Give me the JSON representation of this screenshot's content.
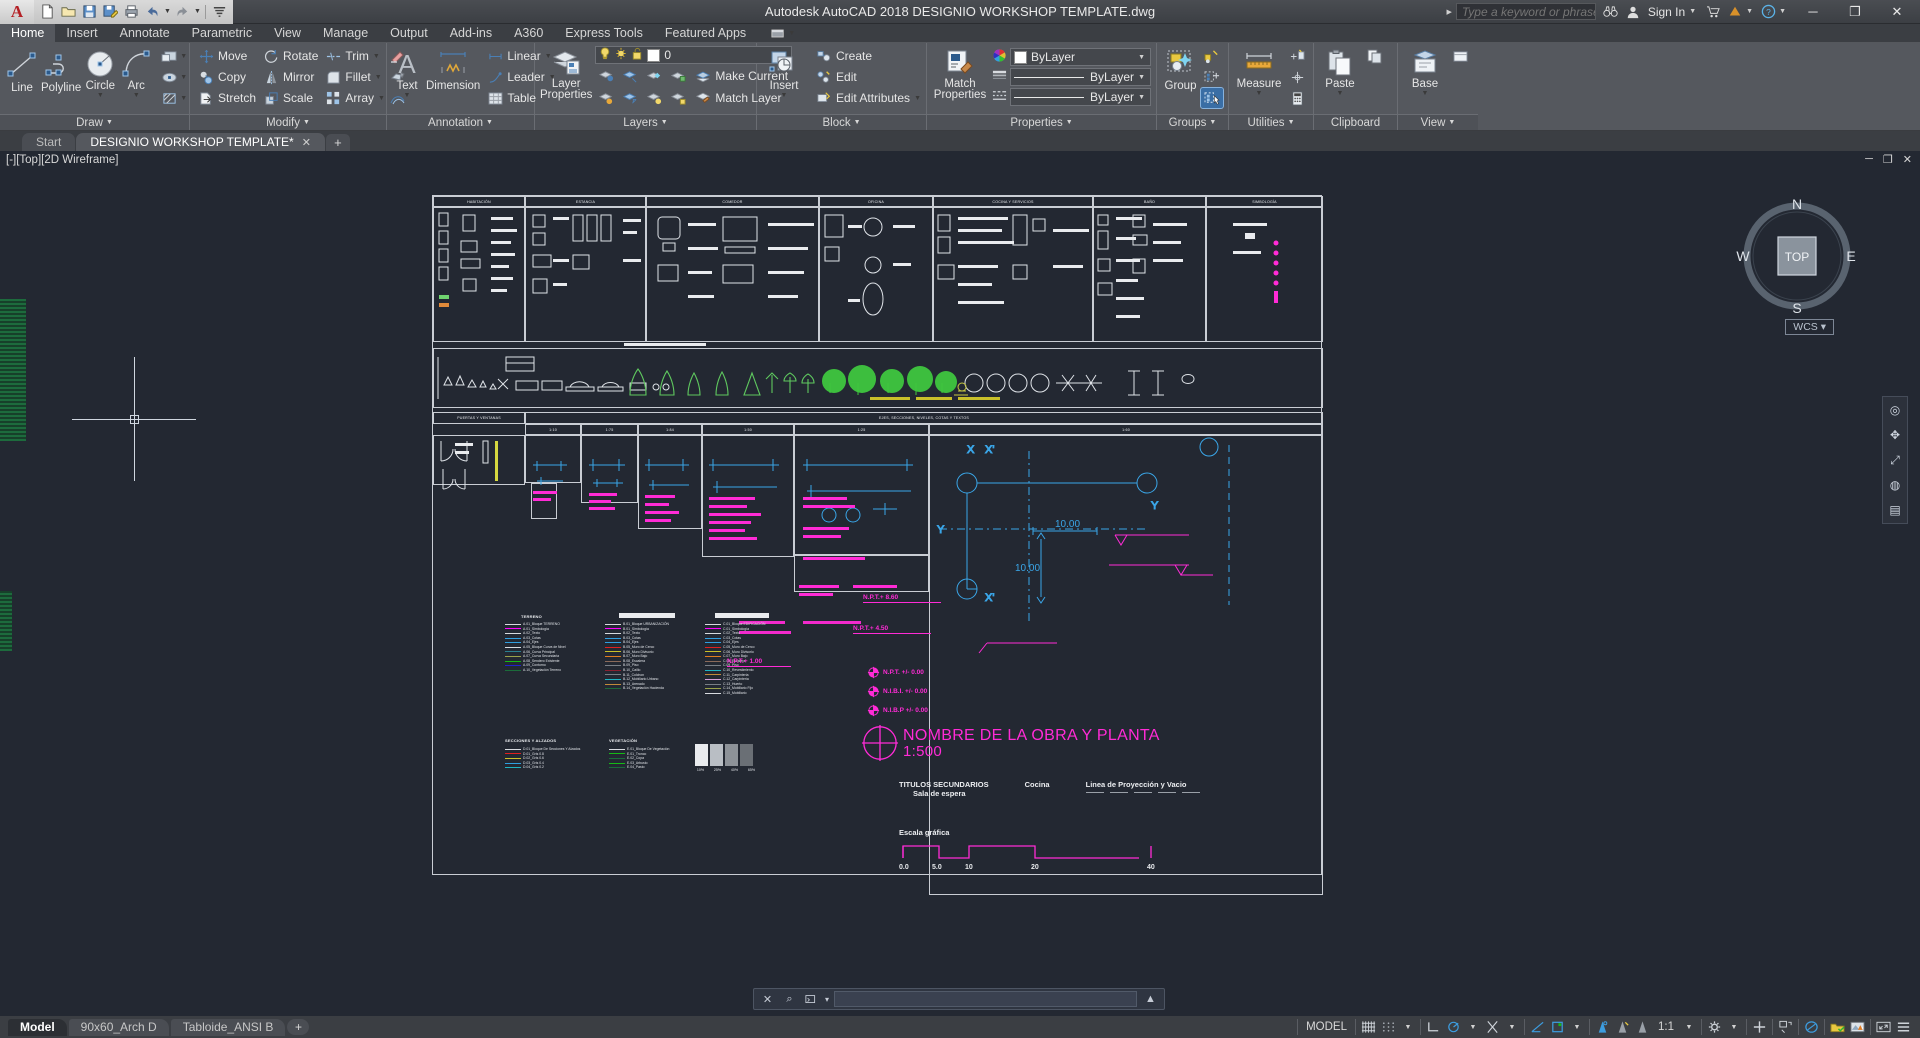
{
  "titlebar": {
    "app_name": "A",
    "title": "Autodesk AutoCAD 2018    DESIGNIO WORKSHOP TEMPLATE.dwg",
    "search_placeholder": "Type a keyword or phrase",
    "signin_label": "Sign In",
    "quick_access": [
      {
        "name": "new-icon",
        "glyph": "▢"
      },
      {
        "name": "open-icon",
        "glyph": "▱"
      },
      {
        "name": "save-icon",
        "glyph": "▣"
      },
      {
        "name": "saveas-icon",
        "glyph": "▤"
      },
      {
        "name": "plot-icon",
        "glyph": "⎙"
      },
      {
        "name": "undo-icon",
        "glyph": "↩"
      },
      {
        "name": "redo-icon",
        "glyph": "↪"
      },
      {
        "name": "customize-icon",
        "glyph": "≡"
      }
    ],
    "window_buttons": {
      "minimize": "─",
      "restore": "❐",
      "close": "✕"
    }
  },
  "ribbon_tabs": {
    "items": [
      "Home",
      "Insert",
      "Annotate",
      "Parametric",
      "View",
      "Manage",
      "Output",
      "Add-ins",
      "A360",
      "Express Tools",
      "Featured Apps"
    ],
    "active": "Home"
  },
  "ribbon": {
    "draw": {
      "title": "Draw",
      "big": [
        {
          "label": "Line",
          "icon": "line-icon"
        },
        {
          "label": "Polyline",
          "icon": "polyline-icon"
        },
        {
          "label": "Circle",
          "icon": "circle-icon",
          "has_menu": true
        },
        {
          "label": "Arc",
          "icon": "arc-icon",
          "has_menu": true
        }
      ],
      "small_icons": [
        {
          "name": "rectangle-icon"
        },
        {
          "name": "ellipse-icon"
        },
        {
          "name": "hatch-icon"
        }
      ]
    },
    "modify": {
      "title": "Modify",
      "col1": [
        "Move",
        "Copy",
        "Stretch"
      ],
      "col2": [
        "Rotate",
        "Mirror",
        "Scale"
      ],
      "col3": [
        "Trim",
        "Fillet",
        "Array"
      ],
      "extra_icons": [
        "erase-icon",
        "explode-icon",
        "offset-icon"
      ]
    },
    "annotation": {
      "title": "Annotation",
      "text_label": "Text",
      "dimension_label": "Dimension",
      "items": [
        "Linear",
        "Leader",
        "Table"
      ]
    },
    "layers": {
      "title": "Layers",
      "layer_properties_label": "Layer Properties",
      "current_layer": "0",
      "make_current": "Make Current",
      "match_layer": "Match Layer"
    },
    "block": {
      "title": "Block",
      "insert_label": "Insert",
      "items": [
        "Create",
        "Edit",
        "Edit Attributes"
      ]
    },
    "properties": {
      "title": "Properties",
      "color": "ByLayer",
      "linetype": "ByLayer",
      "lineweight": "ByLayer"
    },
    "groups": {
      "title": "Groups",
      "group_label": "Group"
    },
    "utilities": {
      "title": "Utilities",
      "measure_label": "Measure"
    },
    "clipboard": {
      "title": "Clipboard",
      "paste_label": "Paste"
    },
    "view": {
      "title": "View",
      "base_label": "Base"
    }
  },
  "file_tabs": {
    "items": [
      {
        "label": "Start",
        "active": false,
        "closable": false
      },
      {
        "label": "DESIGNIO WORKSHOP TEMPLATE*",
        "active": true,
        "closable": true
      }
    ],
    "new_tab": "+"
  },
  "viewport": {
    "label": "[-][Top][2D Wireframe]",
    "controls": [
      "─",
      "❐",
      "✕"
    ],
    "viewcube": {
      "top": "TOP",
      "north": "N",
      "south": "S",
      "east": "E",
      "west": "W"
    },
    "wcs_label": "WCS"
  },
  "drawing": {
    "block_headers": [
      "HABITACIÓN",
      "ESTANCIA",
      "COMEDOR",
      "OFICINA",
      "COCINA Y SERVICIOS",
      "BAÑO",
      "SIMBOLOGÍA"
    ],
    "band3_left_header": "PUERTAS Y VENTANAS",
    "band3_right_header": "EJES, SECCIONES, NIVELES, COTAS Y TEXTOS",
    "scale_columns": [
      "1:10",
      "1:75",
      "1:84",
      "1:50",
      "1:25",
      "1:60"
    ],
    "legend_title_1": "TERRENO",
    "legend_1": [
      {
        "text": "A.01_Bloque TERRENO",
        "color": "#d8dbe0"
      },
      {
        "text": "A.01_Simbología",
        "color": "#ff00ff"
      },
      {
        "text": "A.02_Texto",
        "color": "#d8dbe0"
      },
      {
        "text": "A.03_Cotas",
        "color": "#2f9fe0"
      },
      {
        "text": "A.04_Ejes",
        "color": "#2f9fe0"
      },
      {
        "text": "A.05_Bloque Curva de Nivel",
        "color": "#d8dbe0"
      },
      {
        "text": "A.06_Curva Principal",
        "color": "#2a7f8f"
      },
      {
        "text": "A.07_Curva Secundaria",
        "color": "#9aa24a"
      },
      {
        "text": "A.08_Sendero Existente",
        "color": "#15b915"
      },
      {
        "text": "A.09_Contorno",
        "color": "#2020cc"
      },
      {
        "text": "A.10_Vegetación Terreno",
        "color": "#1b6b3a"
      }
    ],
    "legend_2": [
      {
        "text": "B.01_Bloque URBANIZACIÓN",
        "color": "#d8dbe0"
      },
      {
        "text": "B.01_Simbología",
        "color": "#ff00ff"
      },
      {
        "text": "B.02_Texto",
        "color": "#d8dbe0"
      },
      {
        "text": "B.03_Cotas",
        "color": "#2f9fe0"
      },
      {
        "text": "B.04_Ejes",
        "color": "#2f9fe0"
      },
      {
        "text": "B.05_Muro de Cerco",
        "color": "#e02020"
      },
      {
        "text": "B.06_Muro Divisorio",
        "color": "#c9c02a"
      },
      {
        "text": "B.07_Muro Bajo",
        "color": "#e07b20"
      },
      {
        "text": "B.08_Escalera",
        "color": "#8a6a5a"
      },
      {
        "text": "B.09_Piso",
        "color": "#7a7f86"
      },
      {
        "text": "B.10_Caillo",
        "color": "#8a2030"
      },
      {
        "text": "B.11_Colchon",
        "color": "#7a7f86"
      },
      {
        "text": "B.12_Mobiliario Urbano",
        "color": "#1fb5c4"
      },
      {
        "text": "B.13_Arenado",
        "color": "#c08a3a"
      },
      {
        "text": "B.14_Vegetación Hacienda",
        "color": "#1b6b3a"
      }
    ],
    "legend_3": [
      {
        "text": "C.01_Bloque EDIFICACIÓN",
        "color": "#d8dbe0"
      },
      {
        "text": "C.01_Simbología",
        "color": "#ff00ff"
      },
      {
        "text": "C.02_Texto",
        "color": "#d8dbe0"
      },
      {
        "text": "C.03_Cotas",
        "color": "#2f9fe0"
      },
      {
        "text": "C.04_Ejes",
        "color": "#2f9fe0"
      },
      {
        "text": "C.05_Muro de Cerco",
        "color": "#e02020"
      },
      {
        "text": "C.06_Muro Divisorio",
        "color": "#c9c02a"
      },
      {
        "text": "C.07_Muro Bajo",
        "color": "#e07b20"
      },
      {
        "text": "C.08_Escalera",
        "color": "#8a6a5a"
      },
      {
        "text": "C.09_Piso",
        "color": "#7a7f86"
      },
      {
        "text": "C.10_Revestimiento",
        "color": "#1fb5c4"
      },
      {
        "text": "C.11_Carpintería",
        "color": "#c08a3a"
      },
      {
        "text": "C.12_Carpintería",
        "color": "#d8a0d8"
      },
      {
        "text": "C.13_Huerto",
        "color": "#7a7f86"
      },
      {
        "text": "C.14_Mobiliario Fijo",
        "color": "#9aa24a"
      },
      {
        "text": "C.15_Mobiliario",
        "color": "#d8dbe0"
      }
    ],
    "legend_title_4": "SECCIONES Y ALZADOS",
    "legend_4": [
      {
        "text": "D.01_Bloque De Secciones Y Alzados",
        "color": "#d8dbe0"
      },
      {
        "text": "D.01_Gris 0.8",
        "color": "#e02020"
      },
      {
        "text": "D.02_Gris 0.6",
        "color": "#c9c02a"
      },
      {
        "text": "D.03_Gris 0.4",
        "color": "#2f9fe0"
      },
      {
        "text": "D.04_Gris 0.2",
        "color": "#1fb5c4"
      }
    ],
    "legend_title_5": "VEGETACIÓN",
    "legend_5": [
      {
        "text": "E.01_Bloque De Vegetación",
        "color": "#d8dbe0"
      },
      {
        "text": "E.01_Tronco",
        "color": "#15b915"
      },
      {
        "text": "E.02_Copa",
        "color": "#1b6b3a"
      },
      {
        "text": "E.03_Arbusto",
        "color": "#15b915"
      },
      {
        "text": "E.04_Pasto",
        "color": "#1b6b3a"
      }
    ],
    "gray_swatches": [
      "10%",
      "25%",
      "40%",
      "65%"
    ],
    "title_main": "NOMBRE DE LA OBRA Y PLANTA",
    "title_scale": "1:500",
    "secondary_title": "TITULOS SECUNDARIOS",
    "secondary_sub": "Sala de espera",
    "secondary_mid": "Cocina",
    "secondary_right": "Linea de Proyección y Vacio",
    "graphic_scale_label": "Escala gráfica",
    "graphic_scale_ticks": [
      "0.0",
      "5.0",
      "10",
      "20",
      "40"
    ],
    "npt_labels": [
      "N.P.T.+    8.60",
      "N.P.T.+    4.50",
      "N.P.T.+ 1.00",
      "N.P.T.  +/- 0.00",
      "N.I.B.I. +/- 0.00",
      "N.I.B.P +/- 0.00"
    ],
    "dim_labels": [
      "10.00",
      "10.00"
    ],
    "axis_labels": [
      "X",
      "Y",
      "X'",
      "Y'"
    ],
    "plan_note": "NOMBRE DE LA OBRA Y PLANTA"
  },
  "command_line": {
    "value": "",
    "placeholder": "",
    "close_icon": "✕",
    "search_icon": "⌕",
    "prompt_icon": "⌫",
    "expand_icon": "▲"
  },
  "layout_tabs": {
    "items": [
      {
        "label": "Model",
        "active": true
      },
      {
        "label": "90x60_Arch D",
        "active": false
      },
      {
        "label": "Tabloide_ANSI B",
        "active": false
      }
    ],
    "new_tab": "+"
  },
  "status_bar": {
    "space": "MODEL",
    "scale": "1:1",
    "items": [
      {
        "name": "grid-toggle",
        "glyph": "░"
      },
      {
        "name": "snap-toggle",
        "glyph": "⋯"
      },
      {
        "name": "ortho-toggle",
        "glyph": "∟"
      },
      {
        "name": "polar-toggle",
        "glyph": "◔"
      },
      {
        "name": "osnap-toggle",
        "glyph": "✕"
      },
      {
        "name": "otrack-toggle",
        "glyph": "∠"
      },
      {
        "name": "ucs-icon",
        "glyph": "▣"
      },
      {
        "name": "annotation-visibility-icon",
        "glyph": "⤴"
      },
      {
        "name": "autoscale-icon",
        "glyph": "⤵"
      },
      {
        "name": "annotation-scale-icon",
        "glyph": "⤳"
      },
      {
        "name": "workspace-icon",
        "glyph": "⚙"
      },
      {
        "name": "hardware-accel-icon",
        "glyph": "✛"
      },
      {
        "name": "isolate-objects-icon",
        "glyph": "⧉"
      },
      {
        "name": "clean-screen-icon",
        "glyph": "⤧"
      },
      {
        "name": "customization-icon",
        "glyph": "≡"
      }
    ]
  },
  "colors": {
    "canvas_bg": "#232832",
    "magenta": "#ff00ff",
    "cyan": "#00a8e8",
    "white": "#e9ebee",
    "accent_blue": "#3a6ea5"
  }
}
